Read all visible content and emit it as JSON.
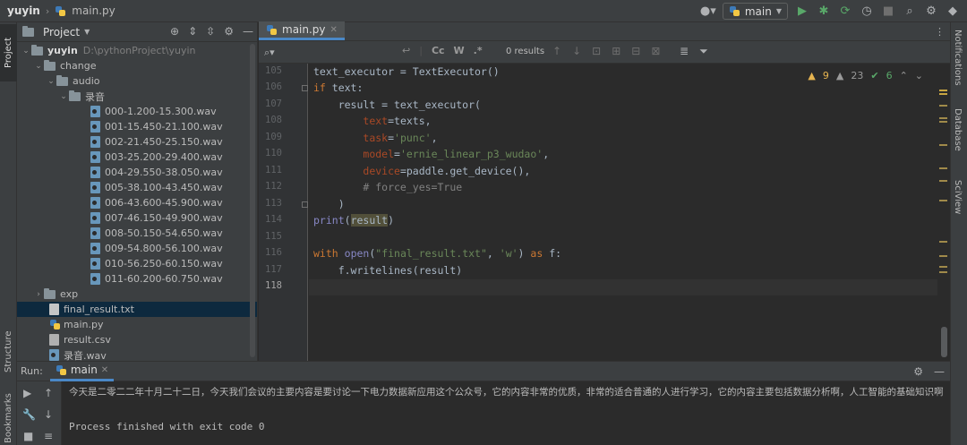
{
  "titlebar": {
    "project": "yuyin",
    "file": "main.py",
    "run_config": "main"
  },
  "left_strip": {
    "project_tab": "Project",
    "structure_tab": "Structure",
    "bookmarks_tab": "Bookmarks"
  },
  "right_strip": {
    "notifications": "Notifications",
    "database": "Database",
    "sciview": "SciView"
  },
  "project_panel": {
    "title": "Project",
    "root_name": "yuyin",
    "root_path": "D:\\pythonProject\\yuyin",
    "change": "change",
    "audio": "audio",
    "recording_folder": "录音",
    "wav_files": [
      "000-1.200-15.300.wav",
      "001-15.450-21.100.wav",
      "002-21.450-25.150.wav",
      "003-25.200-29.400.wav",
      "004-29.550-38.050.wav",
      "005-38.100-43.450.wav",
      "006-43.600-45.900.wav",
      "007-46.150-49.900.wav",
      "008-50.150-54.650.wav",
      "009-54.800-56.100.wav",
      "010-56.250-60.150.wav",
      "011-60.200-60.750.wav"
    ],
    "exp": "exp",
    "final_result": "final_result.txt",
    "main_py": "main.py",
    "result_csv": "result.csv",
    "recording_wav": "录音.wav"
  },
  "editor": {
    "tab": "main.py",
    "find_results": "0 results",
    "find_cc": "Cc",
    "find_w": "W",
    "find_regex": ".*",
    "warnings": "9",
    "weak_warnings": "23",
    "ok_count": "6",
    "line_numbers": [
      "105",
      "106",
      "107",
      "108",
      "109",
      "110",
      "111",
      "112",
      "113",
      "114",
      "115",
      "116",
      "117",
      "118"
    ]
  },
  "run_panel": {
    "label": "Run:",
    "tab": "main",
    "output_line": "今天是二零二二年十月二十二日，今天我们会议的主要内容是要讨论一下电力数据新应用这个公众号，它的内容非常的优质，非常的适合普通的人进行学习，它的内容主要包括数据分析啊，人工智能的基础知识啊",
    "exit_line": "Process finished with exit code 0"
  }
}
